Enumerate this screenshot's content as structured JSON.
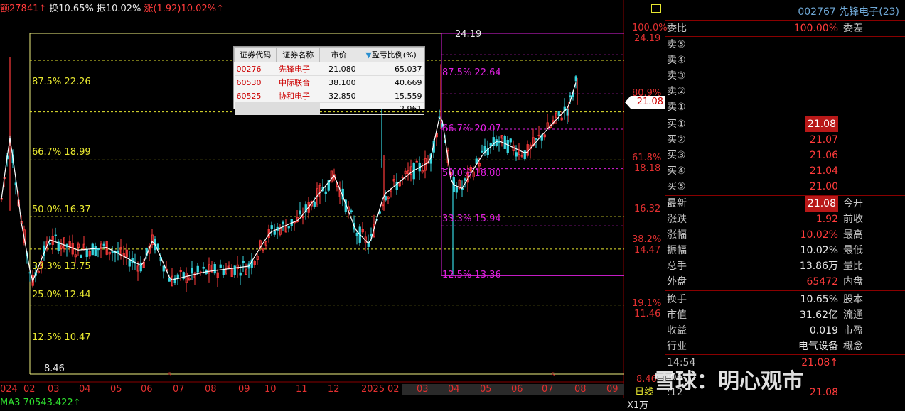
{
  "header": {
    "amount_label": "额27841↑",
    "turnover_label": "换10.65%",
    "amplitude_label": "振10.02%",
    "change_label": "涨(1.92)10.02%↑"
  },
  "chart_data": {
    "type": "candlestick",
    "ylim": [
      8.46,
      24.19
    ],
    "y_scale": "log",
    "fib_left": [
      {
        "label": "87.5% 22.26",
        "value": 22.26
      },
      {
        "label": "66.7% 18.99",
        "value": 18.99
      },
      {
        "label": "50.0% 16.37",
        "value": 16.37
      },
      {
        "label": "33.3% 13.75",
        "value": 13.75
      },
      {
        "label": "25.0% 12.44",
        "value": 12.44
      },
      {
        "label": "12.5% 10.47",
        "value": 10.47
      }
    ],
    "low_label": "8.46",
    "high_label": "24.19",
    "fib_right": [
      {
        "label": "87.5% 22.64",
        "value": 22.64
      },
      {
        "label": "66.7% 20.07",
        "value": 20.07
      },
      {
        "label": "50.0% 18.00",
        "value": 18.0
      },
      {
        "label": "33.3% 15.94",
        "value": 15.94
      },
      {
        "label": "12.5% 13.36",
        "value": 13.36
      }
    ],
    "right_axis": [
      {
        "pct": "100.0%",
        "price": "24.19"
      },
      {
        "pct": "80.9%",
        "price": ""
      },
      {
        "pct": "61.8%",
        "price": "18.18"
      },
      {
        "pct": "",
        "price": "16.32"
      },
      {
        "pct": "38.2%",
        "price": "14.47"
      },
      {
        "pct": "19.1%",
        "price": "11.46"
      },
      {
        "pct": "",
        "price": "8.46"
      }
    ],
    "x_ticks": [
      "024",
      "02",
      "03",
      "04",
      "05",
      "06",
      "07",
      "08",
      "09",
      "10",
      "11",
      "12",
      "2025",
      "02",
      "03",
      "04",
      "05",
      "06",
      "07",
      "08",
      "09"
    ],
    "ma_label": "MA3 70543.422↑",
    "last_price": "21.08",
    "period_label": "日线",
    "scale_label": "X1万"
  },
  "popup": {
    "headers": [
      "证券代码",
      "证券名称",
      "市价",
      "盈亏比例(%)"
    ],
    "rows": [
      [
        "00276",
        "先锋电子",
        "21.080",
        "65.037"
      ],
      [
        "60530",
        "中际联合",
        "38.100",
        "40.669"
      ],
      [
        "60525",
        "协和电子",
        "32.850",
        "15.559"
      ],
      [
        "",
        "",
        "",
        "2.961"
      ]
    ]
  },
  "quote": {
    "code": "002767",
    "name": "先锋电子(23)",
    "weibi_label": "委比",
    "weibi_value": "100.00%",
    "weicha_label": "委差",
    "sells": [
      "卖⑤",
      "卖④",
      "卖③",
      "卖②",
      "卖①"
    ],
    "buys": [
      {
        "label": "买①",
        "value": "21.08"
      },
      {
        "label": "买②",
        "value": "21.07"
      },
      {
        "label": "买③",
        "value": "21.06"
      },
      {
        "label": "买④",
        "value": "21.04"
      },
      {
        "label": "买⑤",
        "value": "21.00"
      }
    ],
    "stats": [
      {
        "l": "最新",
        "v": "21.08",
        "r": "今开"
      },
      {
        "l": "涨跌",
        "v": "1.92",
        "r": "前收"
      },
      {
        "l": "涨幅",
        "v": "10.02%",
        "r": "最高"
      },
      {
        "l": "振幅",
        "v": "10.02%",
        "r": "最低"
      },
      {
        "l": "总手",
        "v": "13.86万",
        "r": "量比"
      },
      {
        "l": "外盘",
        "v": "65472",
        "r": "内盘"
      }
    ],
    "stats2": [
      {
        "l": "换手",
        "v": "10.65%",
        "r": "股本"
      },
      {
        "l": "市值",
        "v": "31.62亿",
        "r": "流通"
      },
      {
        "l": "收益",
        "v": "0.019",
        "r": "市盈"
      },
      {
        "l": "行业",
        "v": "电气设备",
        "r": "概念"
      }
    ],
    "ticks": [
      {
        "time": "14:54",
        "price": "21.08↑"
      },
      {
        "time": ":06",
        "price": ""
      },
      {
        "time": ":12",
        "price": "21.08"
      }
    ]
  },
  "watermark": "雪球：明心观市",
  "colors": {
    "up": "#ff3b3b",
    "down": "#36d6e0",
    "fib_left": "#e8e830",
    "fib_right": "#e020e0",
    "ma": "#ffffff"
  }
}
